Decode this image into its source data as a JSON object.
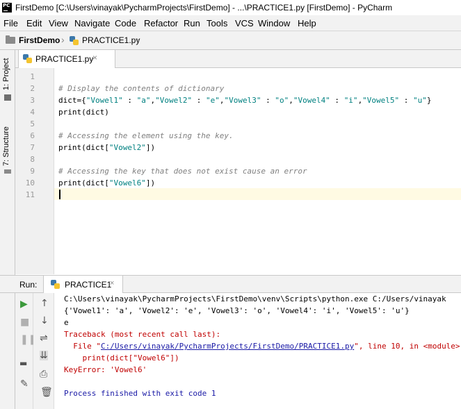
{
  "window": {
    "app_icon": "PC",
    "title": "FirstDemo [C:\\Users\\vinayak\\PycharmProjects\\FirstDemo] - ...\\PRACTICE1.py [FirstDemo] - PyCharm"
  },
  "menu": {
    "items": [
      "File",
      "Edit",
      "View",
      "Navigate",
      "Code",
      "Refactor",
      "Run",
      "Tools",
      "VCS",
      "Window",
      "Help"
    ]
  },
  "breadcrumb": {
    "project": "FirstDemo",
    "file": "PRACTICE1.py"
  },
  "side_tools": {
    "project": "1: Project",
    "structure": "7: Structure"
  },
  "editor": {
    "tab_label": "PRACTICE1.py",
    "tab_close": "×",
    "line_numbers": [
      "1",
      "2",
      "3",
      "4",
      "5",
      "6",
      "7",
      "8",
      "9",
      "10",
      "11"
    ],
    "line2_comment": "# Display the contents of dictionary",
    "line3": {
      "p1": "dict={",
      "k1": "\"Vowel1\"",
      "s1": " : ",
      "v1": "\"a\"",
      "c1": ",",
      "k2": "\"Vowel2\"",
      "s2": " : ",
      "v2": "\"e\"",
      "c2": ",",
      "k3": "\"Vowel3\"",
      "s3": " : ",
      "v3": "\"o\"",
      "c3": ",",
      "k4": "\"Vowel4\"",
      "s4": " : ",
      "v4": "\"i\"",
      "c4": ",",
      "k5": "\"Vowel5\"",
      "s5": " : ",
      "v5": "\"u\"",
      "end": "}"
    },
    "line4": "print(dict)",
    "line6_comment": "# Accessing the element using the key.",
    "line7": {
      "pre": "print(dict[",
      "str": "\"Vowel2\"",
      "post": "])"
    },
    "line9_comment": "# Accessing the key that does not exist cause an error",
    "line10": {
      "pre": "print(dict[",
      "str": "\"Vowel6\"",
      "post": "])"
    }
  },
  "run_panel": {
    "label": "Run:",
    "tab_label": "PRACTICE1",
    "tab_close": "×",
    "console": {
      "cmd": "C:\\Users\\vinayak\\PycharmProjects\\FirstDemo\\venv\\Scripts\\python.exe C:/Users/vinayak",
      "dict_output": "{'Vowel1': 'a', 'Vowel2': 'e', 'Vowel3': 'o', 'Vowel4': 'i', 'Vowel5': 'u'}",
      "e_output": "e",
      "traceback": "Traceback (most recent call last):",
      "file_prefix": "  File \"",
      "file_link": "C:/Users/vinayak/PycharmProjects/FirstDemo/PRACTICE1.py",
      "file_suffix": "\", line 10, in <module>",
      "code_line": "    print(dict[\"Vowel6\"])",
      "error": "KeyError: 'Vowel6'",
      "exit": "Process finished with exit code 1"
    }
  },
  "icons": {
    "run": "play-icon",
    "stop": "stop-icon",
    "pause": "pause-icon",
    "up": "arrow-up-icon",
    "down": "arrow-down-icon",
    "wrap": "soft-wrap-icon",
    "scroll": "scroll-to-end-icon",
    "print": "print-icon",
    "delete": "trash-icon",
    "pin": "pin-icon",
    "layout": "layout-icon"
  },
  "colors": {
    "comment": "#808080",
    "string": "#008080",
    "error": "#c00000",
    "link": "#1a1aa6",
    "run_green": "#3c9a3c",
    "current_line": "#fffae3"
  }
}
